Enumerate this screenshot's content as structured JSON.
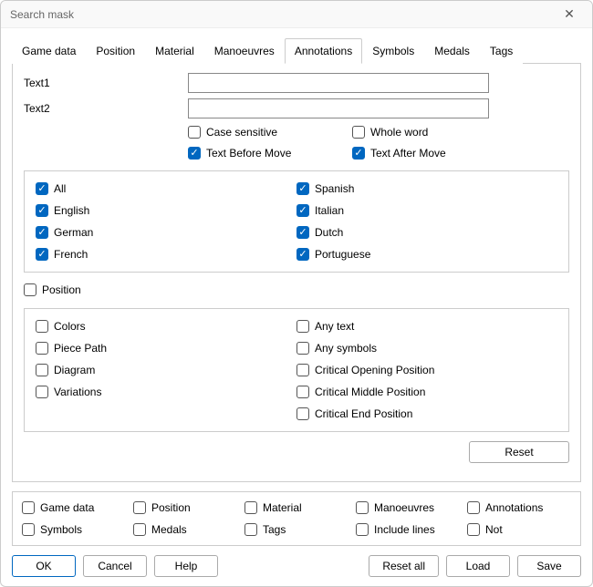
{
  "window": {
    "title": "Search mask"
  },
  "tabs": {
    "game_data": "Game data",
    "position": "Position",
    "material": "Material",
    "manoeuvres": "Manoeuvres",
    "annotations": "Annotations",
    "symbols": "Symbols",
    "medals": "Medals",
    "tags": "Tags"
  },
  "fields": {
    "text1_label": "Text1",
    "text2_label": "Text2",
    "text1_value": "",
    "text2_value": ""
  },
  "text_opts": {
    "case_sensitive": "Case sensitive",
    "whole_word": "Whole word",
    "text_before": "Text Before Move",
    "text_after": "Text After Move"
  },
  "langs": {
    "all": "All",
    "english": "English",
    "german": "German",
    "french": "French",
    "spanish": "Spanish",
    "italian": "Italian",
    "dutch": "Dutch",
    "portuguese": "Portuguese"
  },
  "position_cb": "Position",
  "attrs": {
    "colors": "Colors",
    "piece_path": "Piece Path",
    "diagram": "Diagram",
    "variations": "Variations",
    "any_text": "Any text",
    "any_symbols": "Any symbols",
    "crit_opening": "Critical Opening Position",
    "crit_middle": "Critical Middle Position",
    "crit_end": "Critical End Position"
  },
  "reset_btn": "Reset",
  "bottom": {
    "game_data": "Game data",
    "position": "Position",
    "material": "Material",
    "manoeuvres": "Manoeuvres",
    "annotations": "Annotations",
    "symbols": "Symbols",
    "medals": "Medals",
    "tags": "Tags",
    "include_lines": "Include lines",
    "not": "Not"
  },
  "footer": {
    "ok": "OK",
    "cancel": "Cancel",
    "help": "Help",
    "reset_all": "Reset all",
    "load": "Load",
    "save": "Save"
  }
}
